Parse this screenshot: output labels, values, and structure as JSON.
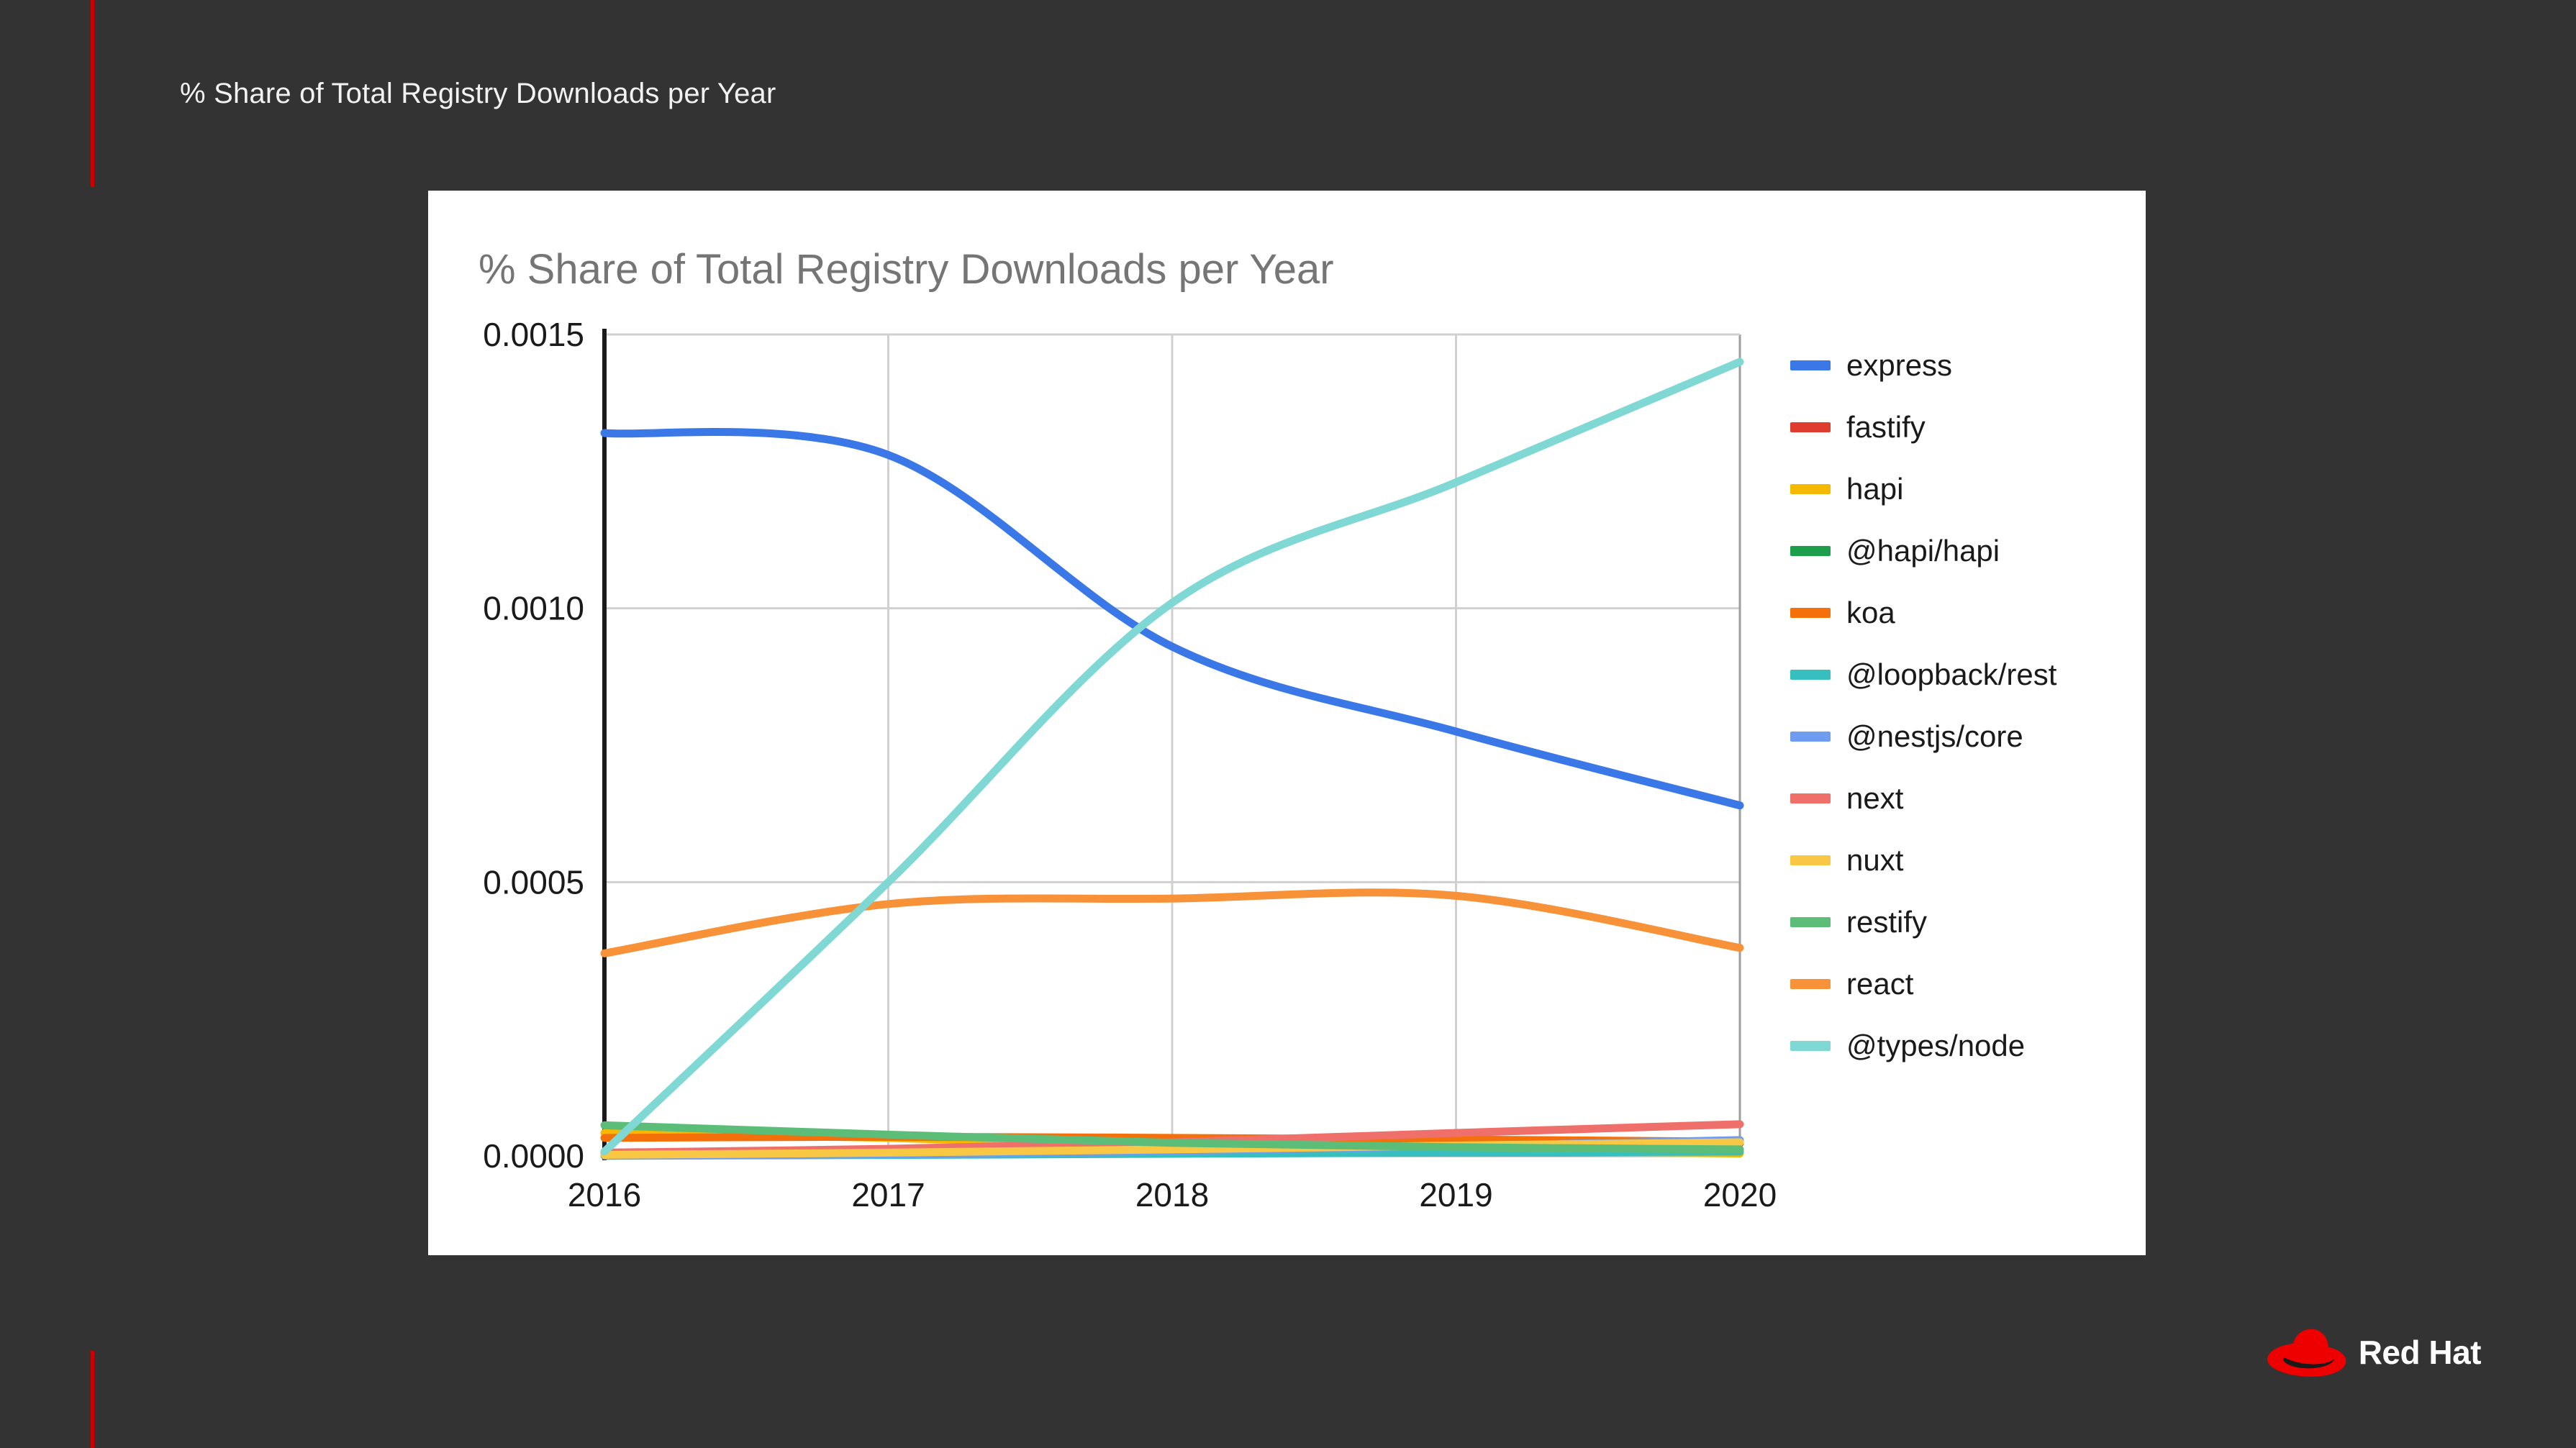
{
  "slide": {
    "title": "% Share of Total Registry Downloads per Year",
    "background_color": "#333333",
    "accent_color": "#cc0000",
    "logo": {
      "name": "Red Hat",
      "wordmark": "Red Hat",
      "hat_color": "#ee0000",
      "band_color": "#1a1a1a"
    }
  },
  "card": {
    "background_color": "#ffffff"
  },
  "chart_data": {
    "type": "line",
    "title": "% Share of Total Registry Downloads per Year",
    "xlabel": "",
    "ylabel": "",
    "x": [
      2016,
      2017,
      2018,
      2019,
      2020
    ],
    "xtick_labels": [
      "2016",
      "2017",
      "2018",
      "2019",
      "2020"
    ],
    "ytick_labels": [
      "0.0000",
      "0.0005",
      "0.0010",
      "0.0015"
    ],
    "yticks": [
      0.0,
      0.0005,
      0.001,
      0.0015
    ],
    "ylim": [
      0.0,
      0.0015
    ],
    "xlim": [
      2016,
      2020
    ],
    "grid": true,
    "legend_position": "right",
    "series": [
      {
        "name": "express",
        "color": "#3b78e7",
        "values": [
          0.00132,
          0.00128,
          0.00093,
          0.000775,
          0.00064
        ]
      },
      {
        "name": "fastify",
        "color": "#e03b2f",
        "values": [
          2e-06,
          4.5e-06,
          9e-06,
          1.5e-05,
          2.3e-05
        ]
      },
      {
        "name": "hapi",
        "color": "#f5ba00",
        "values": [
          4.2e-05,
          3.3e-05,
          1.8e-05,
          9e-06,
          4.5e-06
        ]
      },
      {
        "name": "@hapi/hapi",
        "color": "#1d9e4b",
        "values": [
          1e-06,
          6e-06,
          1.5e-05,
          2.1e-05,
          2.6e-05
        ]
      },
      {
        "name": "koa",
        "color": "#f4700a",
        "values": [
          3.3e-05,
          3.5e-05,
          3.3e-05,
          3e-05,
          2.6e-05
        ]
      },
      {
        "name": "@loopback/rest",
        "color": "#37bfc0",
        "values": [
          3e-07,
          1.8e-06,
          4e-06,
          6e-06,
          8e-06
        ]
      },
      {
        "name": "@nestjs/core",
        "color": "#6f9bf0",
        "values": [
          5e-07,
          3e-06,
          9e-06,
          1.8e-05,
          2.9e-05
        ]
      },
      {
        "name": "next",
        "color": "#ef6f6a",
        "values": [
          6e-06,
          1.3e-05,
          2.5e-05,
          4.2e-05,
          5.8e-05
        ]
      },
      {
        "name": "nuxt",
        "color": "#f8c744",
        "values": [
          2e-06,
          6e-06,
          1.2e-05,
          1.9e-05,
          2.5e-05
        ]
      },
      {
        "name": "restify",
        "color": "#5cbd78",
        "values": [
          5.6e-05,
          3.9e-05,
          2.4e-05,
          1.6e-05,
          1.2e-05
        ]
      },
      {
        "name": "react",
        "color": "#f79239",
        "values": [
          0.00037,
          0.00046,
          0.00047,
          0.000475,
          0.00038
        ]
      },
      {
        "name": "@types/node",
        "color": "#7fd8d4",
        "values": [
          8e-06,
          0.0005,
          0.00101,
          0.00123,
          0.00145
        ]
      }
    ]
  }
}
